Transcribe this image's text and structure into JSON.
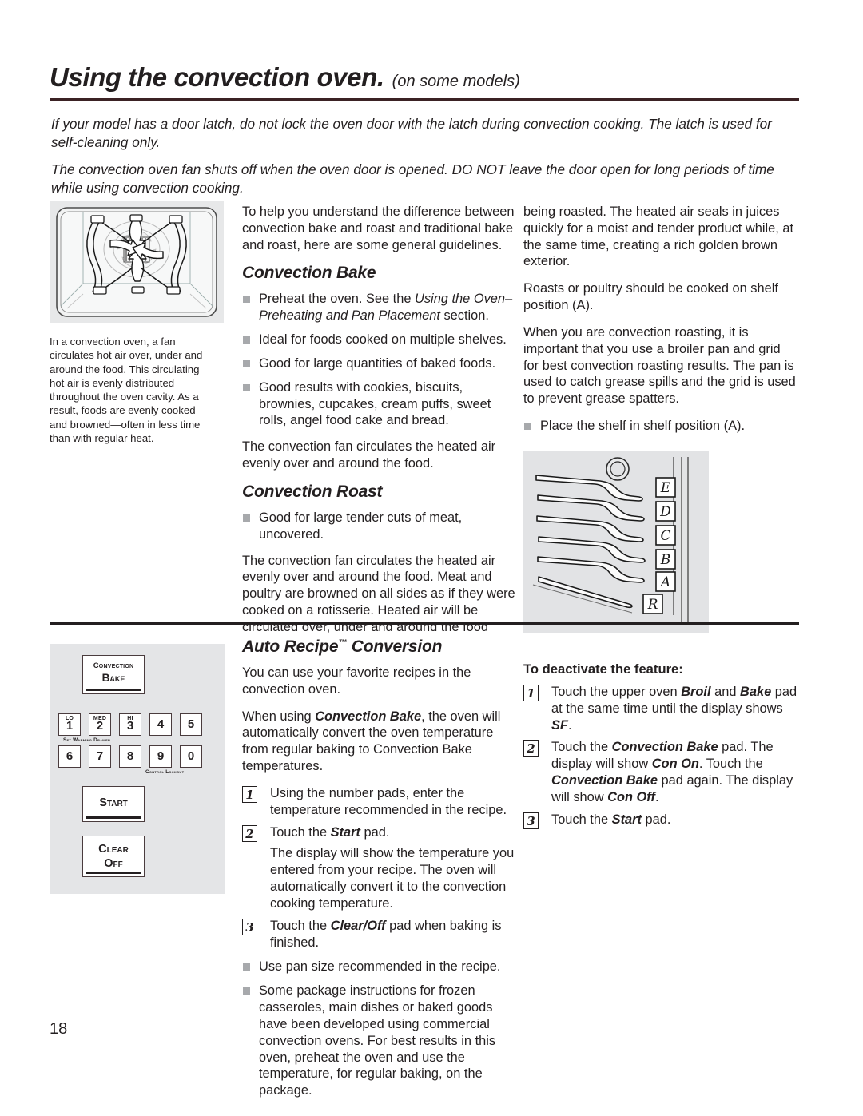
{
  "header": {
    "title": "Using the convection oven.",
    "subtitle": "(on some models)",
    "rule_color": "#3b2224"
  },
  "intro": {
    "note1": "If your model has a door latch, do not lock the oven door with the latch during convection cooking. The latch is used for self-cleaning only.",
    "note2": "The convection oven fan shuts off when the oven door is opened. DO NOT leave the door open for long periods of time while using convection cooking."
  },
  "left_column": {
    "illustration_name": "convection-oven-airflow-diagram",
    "caption": "In a convection oven, a fan circulates hot air over, under and around the food. This circulating hot air is evenly distributed throughout the oven cavity. As a result, foods are evenly cooked and browned—often in less time than with regular heat."
  },
  "middle_column": {
    "intro_paragraph": "To help you understand the difference between convection bake and roast and traditional bake and roast, here are some general guidelines.",
    "convection_bake": {
      "heading": "Convection Bake",
      "bullets": [
        {
          "plain1": "Preheat the oven. See the ",
          "italic": "Using the Oven–Preheating and Pan Placement",
          "plain2": " section."
        },
        {
          "text": "Ideal for foods cooked on multiple shelves."
        },
        {
          "text": "Good for large quantities of baked foods."
        },
        {
          "text": "Good results with cookies, biscuits, brownies, cupcakes, cream puffs, sweet rolls, angel food cake and bread."
        }
      ],
      "closing": "The convection fan circulates the heated air evenly over and around the food."
    },
    "convection_roast": {
      "heading": "Convection Roast",
      "bullets": [
        {
          "text": "Good for large tender cuts of meat, uncovered."
        }
      ],
      "closing": "The convection fan circulates the heated air evenly over and around the food. Meat and poultry are browned on all sides as if they were cooked on a rotisserie. Heated air will be circulated over, under and around the food"
    }
  },
  "right_column": {
    "para1": "being roasted. The heated air seals in juices quickly for a moist and tender product while, at the same time, creating a rich golden brown exterior.",
    "para2": "Roasts or poultry should be cooked on shelf position (A).",
    "para3": "When you are convection roasting, it is important that you use a broiler pan and grid for best convection roasting results. The pan is used to catch grease spills and the grid is used to prevent grease spatters.",
    "bullet1": "Place the shelf in shelf position (A).",
    "shelf_illustration_name": "oven-shelf-positions-diagram",
    "shelf_labels": [
      "E",
      "D",
      "C",
      "B",
      "A",
      "R"
    ]
  },
  "control_panel": {
    "convection_bake_key": {
      "line1": "Convection",
      "line2": "Bake"
    },
    "number_keys_row1": [
      {
        "sup": "LO",
        "num": "1"
      },
      {
        "sup": "MED",
        "num": "2"
      },
      {
        "sup": "HI",
        "num": "3"
      },
      {
        "sup": "",
        "num": "4"
      },
      {
        "sup": "",
        "num": "5"
      }
    ],
    "number_keys_row2": [
      {
        "sup": "",
        "num": "6"
      },
      {
        "sup": "",
        "num": "7"
      },
      {
        "sup": "",
        "num": "8"
      },
      {
        "sup": "",
        "num": "9"
      },
      {
        "sup": "",
        "num": "0"
      }
    ],
    "caption_warming_drawer": "Set Warming Drawer",
    "caption_control_lockout": "Control Lockout",
    "start_key": "Start",
    "clear_off_key": {
      "line1": "Clear",
      "line2": "Off"
    }
  },
  "auto_recipe": {
    "heading": "Auto Recipe",
    "heading_tm": "™",
    "heading_tail": " Conversion",
    "para1": "You can use your favorite recipes in the convection oven.",
    "para2_plain1": "When using ",
    "para2_bold": "Convection Bake",
    "para2_plain2": ", the oven will automatically convert the oven temperature from regular baking to Convection Bake temperatures.",
    "steps": [
      {
        "num": "1",
        "text": "Using the number pads, enter the temperature recommended in the recipe."
      },
      {
        "num": "2",
        "plain1": "Touch the ",
        "bold": "Start",
        "plain2": " pad."
      }
    ],
    "step2_note": "The display will show the temperature you entered from your recipe. The oven will automatically convert it to the convection cooking temperature.",
    "step3": {
      "num": "3",
      "plain1": "Touch the ",
      "bold": "Clear/Off",
      "plain2": " pad when baking is finished."
    },
    "bullets": [
      {
        "text": "Use pan size recommended in the recipe."
      },
      {
        "text": "Some package instructions for frozen casseroles, main dishes or baked goods have been developed using commercial convection ovens. For best results in this oven, preheat the oven and use the temperature, for regular baking, on the package."
      }
    ]
  },
  "deactivate": {
    "heading": "To deactivate the feature:",
    "step1": {
      "num": "1",
      "p1": "Touch the upper oven ",
      "b1": "Broil",
      "p2": " and ",
      "b2": "Bake",
      "p3": " pad at the same time until the display shows ",
      "b3": "SF",
      "p4": "."
    },
    "step2": {
      "num": "2",
      "p1": "Touch the ",
      "b1": "Convection Bake",
      "p2": " pad. The display will show ",
      "b2": "Con On",
      "p3": ". Touch the ",
      "b3": "Convection Bake",
      "p4": " pad again. The display will show ",
      "b4": "Con Off",
      "p5": "."
    },
    "step3": {
      "num": "3",
      "p1": "Touch the ",
      "b1": "Start",
      "p2": " pad."
    }
  },
  "footer": {
    "page_number": "18"
  }
}
